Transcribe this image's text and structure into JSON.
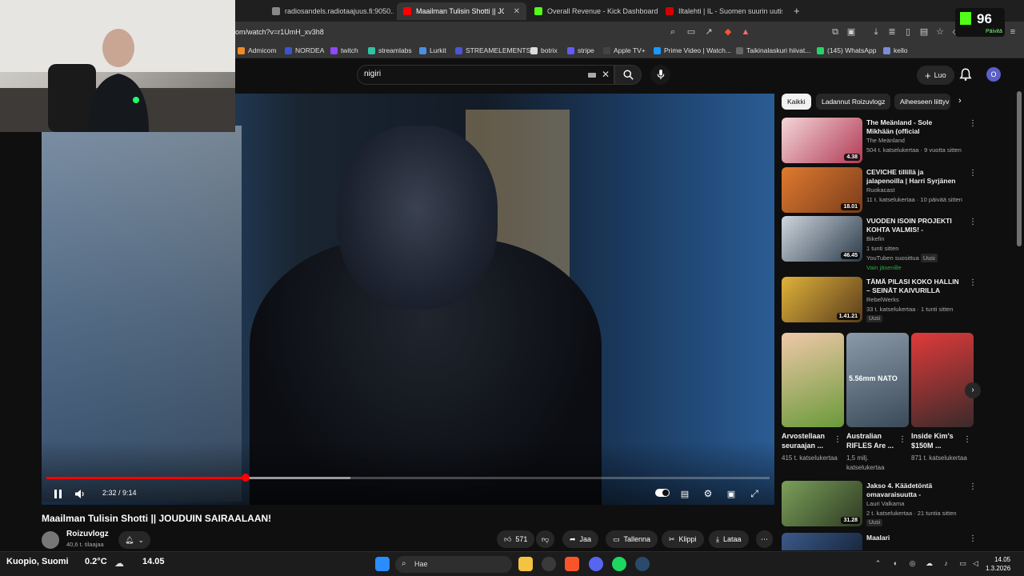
{
  "browser": {
    "tabs": [
      {
        "label": "radiosandels.radiotaajuus.fi:9050...",
        "color": "#888888"
      },
      {
        "label": "Maailman Tulisin Shotti || JOU",
        "color": "#ff0000"
      },
      {
        "label": "Overall Revenue - Kick Dashboard",
        "color": "#53fc18"
      },
      {
        "label": "Iltalehti | IL - Suomen suurin uutispal",
        "color": "#d40000"
      }
    ],
    "new_tab": "+",
    "url": "om/watch?v=r1UmH_xv3h8",
    "bookmarks": [
      {
        "label": "Admicom",
        "color": "#f08a24"
      },
      {
        "label": "NORDEA",
        "color": "#3c54d1"
      },
      {
        "label": "twitch",
        "color": "#9146ff"
      },
      {
        "label": "streamlabs",
        "color": "#31c3a2"
      },
      {
        "label": "Lurkit",
        "color": "#4a90e2"
      },
      {
        "label": "STREAMELEMENTS",
        "color": "#4a55d8"
      },
      {
        "label": "botrix",
        "color": "#dddddd"
      },
      {
        "label": "stripe",
        "color": "#635bff"
      },
      {
        "label": "Apple TV+",
        "color": "#444444"
      },
      {
        "label": "Prime Video | Watch...",
        "color": "#1a98ff"
      },
      {
        "label": "Taikinalaskuri hiivat...",
        "color": "#666666"
      },
      {
        "label": "(145) WhatsApp",
        "color": "#25d366"
      },
      {
        "label": "kello",
        "color": "#7b8dd8"
      }
    ]
  },
  "kick": {
    "count": "96",
    "update": "Päivitä"
  },
  "youtube": {
    "search_query": "nigiri",
    "create_label": "Luo",
    "avatar_letter": "O",
    "player": {
      "time": "2:32 / 9:14",
      "progress_fraction": 0.275,
      "buffer_fraction": 0.42
    },
    "video_title": "Maailman Tulisin Shotti || JOUDUIN SAIRAALAAN!",
    "channel": {
      "name": "Roizuvlogz",
      "subs": "40,6 t. tilaajaa"
    },
    "actions": {
      "likes": "571",
      "share": "Jaa",
      "save": "Tallenna",
      "clip": "Klippi",
      "download": "Lataa"
    },
    "chips": [
      "Kaikki",
      "Ladannut Roizuvlogz",
      "Aiheeseen liittyv"
    ],
    "recommendations": [
      {
        "title": "The Meänland - Sole Mikhään (official musicvideo)",
        "channel": "The Meänland",
        "meta": "504 t. katselukertaa · 9 vuotta sitten",
        "duration": "4.38",
        "badge": "",
        "thumb": [
          "#f3d6d8",
          "#b23a55"
        ]
      },
      {
        "title": "CEVICHE tillillä ja jalapenoilla | Harri Syrjänen vs. Lauri ...",
        "channel": "Ruokacast",
        "meta": "11 t. katselukertaa · 10 päivää sitten",
        "duration": "18.01",
        "badge": "",
        "thumb": [
          "#e07a2f",
          "#7a3d1a"
        ]
      },
      {
        "title": "VUODEN ISOIN PROJEKTI KOHTA VALMIS! - KÄYNTIIN?",
        "channel": "Bikefin",
        "meta": "1 tunti sitten",
        "duration": "46.45",
        "badge": "Uusi",
        "thumb": [
          "#cfd7de",
          "#2b3a4a"
        ]
      },
      {
        "title": "TÄMÄ PILASI KOKO HALLIN – SEINÄT KAIVURILLA MAAN ...",
        "channel": "RebelWerks",
        "meta": "33 t. katselukertaa · 1 tunti sitten",
        "duration": "1.41.21",
        "badge": "Uusi",
        "thumb": [
          "#e0b23a",
          "#5a3d1c"
        ]
      },
      {
        "title": "Jakso 4. Käädetöntä omavaraisuutta - Mokattiinko?...",
        "channel": "Lauri Valkama",
        "meta": "2 t. katselukertaa · 21 tuntia sitten",
        "duration": "31.28",
        "badge": "Uusi",
        "thumb": [
          "#7aa05a",
          "#2f3a22"
        ]
      },
      {
        "title": "Maalari",
        "channel": "Bublo - Topic",
        "meta": "",
        "duration": "",
        "badge": "",
        "thumb": [
          "#3a5a8a",
          "#101a2a"
        ]
      }
    ],
    "rec3_extra": {
      "suggested": "YouTuben suosittua",
      "members": "Vain jäsenille"
    },
    "shorts": [
      {
        "title": "Arvostellaan seuraajan ...",
        "views": "415 t. katselukertaa",
        "thumb": [
          "#f0c8a8",
          "#6a9a3a"
        ]
      },
      {
        "title": "Australian RIFLES Are ...",
        "views": "1,5 milj. katselukertaa",
        "thumb": [
          "#8a9aa8",
          "#3a4a58"
        ],
        "overlay": "5.56mm NATO"
      },
      {
        "title": "Inside Kim's $150M ...",
        "views": "871 t. katselukertaa",
        "thumb": [
          "#e03a3a",
          "#3a2a2a"
        ]
      }
    ]
  },
  "taskbar": {
    "weather_location": "Kuopio, Suomi",
    "weather_temp": "0.2°C",
    "time_small": "14.05",
    "search_placeholder": "Hae",
    "clock_time": "14.05",
    "clock_date": "1.3.2026",
    "apps": [
      {
        "name": "windows-start",
        "color": "#2a8cff"
      },
      {
        "name": "file-explorer",
        "color": "#f5c342"
      },
      {
        "name": "steam-like",
        "color": "#3a3a3a"
      },
      {
        "name": "brave",
        "color": "#fb542b"
      },
      {
        "name": "discord",
        "color": "#5865f2"
      },
      {
        "name": "spotify",
        "color": "#1ed760"
      },
      {
        "name": "steam",
        "color": "#1b2838"
      }
    ]
  }
}
